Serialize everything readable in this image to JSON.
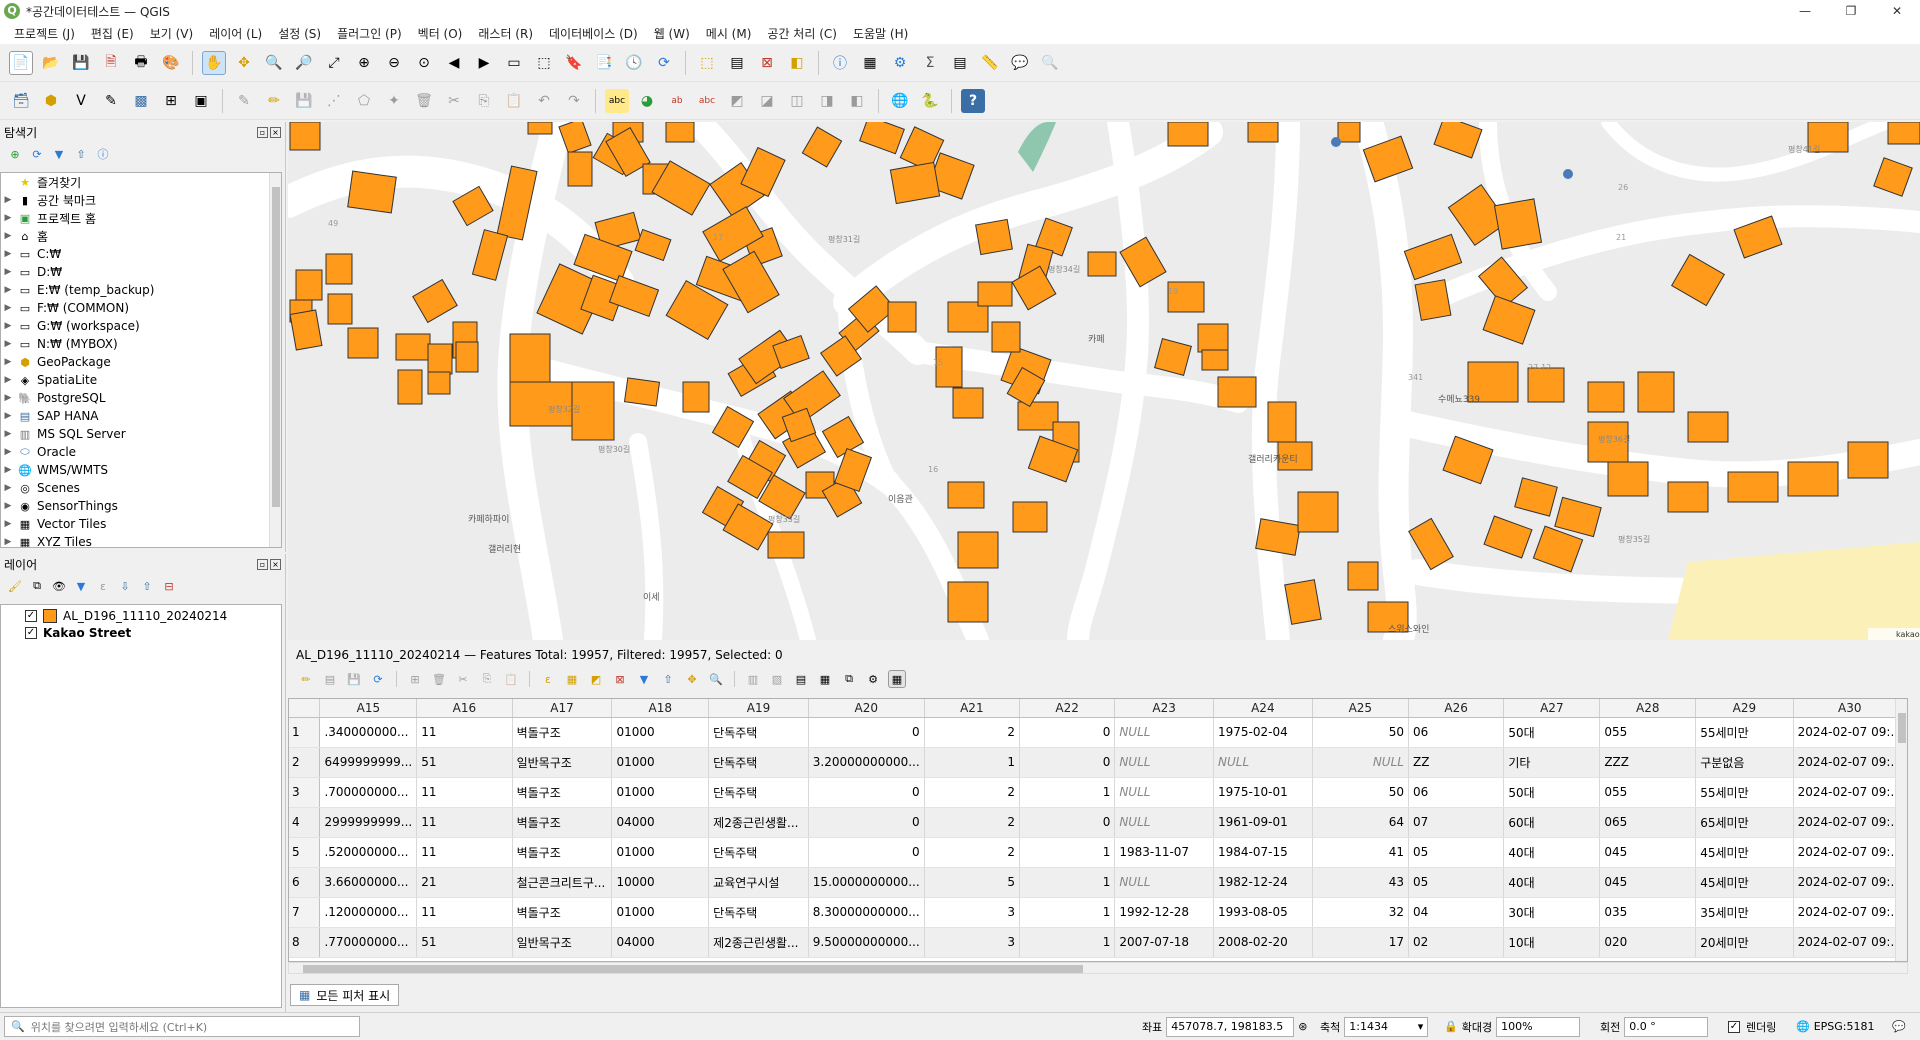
{
  "window": {
    "title": "*공간데이터테스트 — QGIS",
    "logo": "Q"
  },
  "menu": [
    "프로젝트 (J)",
    "편집 (E)",
    "보기 (V)",
    "레이어 (L)",
    "설정 (S)",
    "플러그인 (P)",
    "벡터 (O)",
    "래스터 (R)",
    "데이터베이스 (D)",
    "웹 (W)",
    "메시 (M)",
    "공간 처리 (C)",
    "도움말 (H)"
  ],
  "browser": {
    "title": "탐색기",
    "items": [
      {
        "label": "즐겨찾기",
        "icon": "star-icon"
      },
      {
        "label": "공간 북마크",
        "icon": "bookmark-icon"
      },
      {
        "label": "프로젝트 홈",
        "icon": "project-home-icon"
      },
      {
        "label": "홈",
        "icon": "home-folder-icon"
      },
      {
        "label": "C:₩",
        "icon": "drive-icon"
      },
      {
        "label": "D:₩",
        "icon": "drive-icon"
      },
      {
        "label": "E:₩ (temp_backup)",
        "icon": "drive-icon"
      },
      {
        "label": "F:₩ (COMMON)",
        "icon": "drive-icon"
      },
      {
        "label": "G:₩ (workspace)",
        "icon": "drive-icon"
      },
      {
        "label": "N:₩ (MYBOX)",
        "icon": "drive-icon"
      },
      {
        "label": "GeoPackage",
        "icon": "geopackage-icon"
      },
      {
        "label": "SpatiaLite",
        "icon": "spatialite-icon"
      },
      {
        "label": "PostgreSQL",
        "icon": "postgresql-icon"
      },
      {
        "label": "SAP HANA",
        "icon": "sap-hana-icon"
      },
      {
        "label": "MS SQL Server",
        "icon": "mssql-icon"
      },
      {
        "label": "Oracle",
        "icon": "oracle-icon"
      },
      {
        "label": "WMS/WMTS",
        "icon": "wms-icon"
      },
      {
        "label": "Scenes",
        "icon": "scenes-icon"
      },
      {
        "label": "SensorThings",
        "icon": "sensorthings-icon"
      },
      {
        "label": "Vector Tiles",
        "icon": "vector-tiles-icon"
      },
      {
        "label": "XYZ Tiles",
        "icon": "xyz-tiles-icon"
      }
    ]
  },
  "layers_panel": {
    "title": "레이어",
    "layers": [
      {
        "name": "AL_D196_11110_20240214",
        "checked": true,
        "color": "#ff9a1a"
      },
      {
        "name": "Kakao Street",
        "checked": true
      }
    ]
  },
  "attribute_table": {
    "title": "AL_D196_11110_20240214 — Features Total: 19957, Filtered: 19957, Selected: 0",
    "columns": [
      "A15",
      "A16",
      "A17",
      "A18",
      "A19",
      "A20",
      "A21",
      "A22",
      "A23",
      "A24",
      "A25",
      "A26",
      "A27",
      "A28",
      "A29",
      "A30"
    ],
    "rows": [
      [
        "1",
        ".340000000...",
        "11",
        "벽돌구조",
        "01000",
        "단독주택",
        "0",
        "2",
        "0",
        "NULL",
        "1975-02-04",
        "50",
        "06",
        "50대",
        "055",
        "55세미만",
        "2024-02-07 09:..."
      ],
      [
        "2",
        "6499999999...",
        "51",
        "일반목구조",
        "01000",
        "단독주택",
        "3.20000000000...",
        "1",
        "0",
        "NULL",
        "NULL",
        "NULL",
        "ZZ",
        "기타",
        "ZZZ",
        "구분없음",
        "2024-02-07 09:..."
      ],
      [
        "3",
        ".700000000...",
        "11",
        "벽돌구조",
        "01000",
        "단독주택",
        "0",
        "2",
        "1",
        "NULL",
        "1975-10-01",
        "50",
        "06",
        "50대",
        "055",
        "55세미만",
        "2024-02-07 09:..."
      ],
      [
        "4",
        "2999999999...",
        "11",
        "벽돌구조",
        "04000",
        "제2종근린생활...",
        "0",
        "2",
        "0",
        "NULL",
        "1961-09-01",
        "64",
        "07",
        "60대",
        "065",
        "65세미만",
        "2024-02-07 09:..."
      ],
      [
        "5",
        ".520000000...",
        "11",
        "벽돌구조",
        "01000",
        "단독주택",
        "0",
        "2",
        "1",
        "1983-11-07",
        "1984-07-15",
        "41",
        "05",
        "40대",
        "045",
        "45세미만",
        "2024-02-07 09:..."
      ],
      [
        "6",
        "3.66000000...",
        "21",
        "철근콘크리트구...",
        "10000",
        "교육연구시설",
        "15.0000000000...",
        "5",
        "1",
        "NULL",
        "1982-12-24",
        "43",
        "05",
        "40대",
        "045",
        "45세미만",
        "2024-02-07 09:..."
      ],
      [
        "7",
        ".120000000...",
        "11",
        "벽돌구조",
        "01000",
        "단독주택",
        "8.30000000000...",
        "3",
        "1",
        "1992-12-28",
        "1993-08-05",
        "32",
        "04",
        "30대",
        "035",
        "35세미만",
        "2024-02-07 09:..."
      ],
      [
        "8",
        ".770000000...",
        "51",
        "일반목구조",
        "04000",
        "제2종근린생활...",
        "9.50000000000...",
        "3",
        "1",
        "2007-07-18",
        "2008-02-20",
        "17",
        "02",
        "10대",
        "020",
        "20세미만",
        "2024-02-07 09:..."
      ]
    ],
    "show_all": "모든 피처 표시"
  },
  "map": {
    "labels": [
      "카페하파이",
      "갤러리현",
      "이세",
      "갤러리카운티",
      "수메뇨339",
      "스위스와인",
      "카페",
      "이음관",
      "평창32길",
      "평창30길",
      "평창31길",
      "평창34길",
      "평창36길",
      "평창35길",
      "평창41길",
      "평창33길",
      "49",
      "17",
      "19",
      "15",
      "341",
      "27-12",
      "26",
      "21",
      "16"
    ],
    "attribution": "kakao",
    "building_color": "#ff9a1a",
    "road_color": "#ffffff",
    "bg_color": "#ececec"
  },
  "status": {
    "search_placeholder": "위치를 찾으려면 입력하세요 (Ctrl+K)",
    "coord_label": "좌표",
    "coord_value": "457078.7, 198183.5",
    "scale_label": "축척",
    "scale_value": "1:1434",
    "magnifier_label": "확대경",
    "magnifier_value": "100%",
    "rotation_label": "회전",
    "rotation_value": "0.0 °",
    "render_label": "렌더링",
    "crs": "EPSG:5181"
  }
}
